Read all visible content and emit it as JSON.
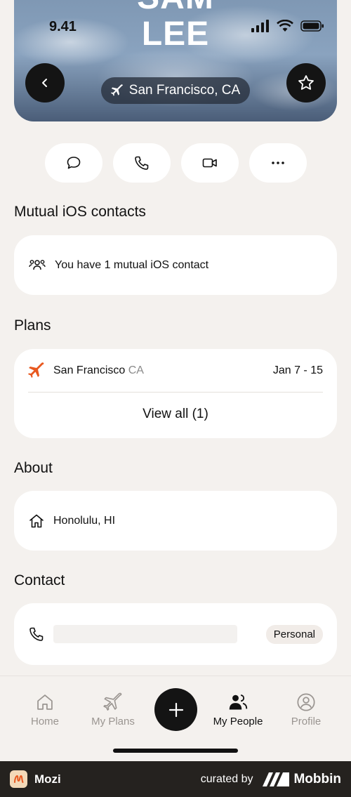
{
  "hero": {
    "name_line1": "SAM",
    "name_line2": "LEE",
    "location": "San Francisco, CA"
  },
  "status_bar": {
    "time": "9.41"
  },
  "sections": {
    "mutual_title": "Mutual iOS contacts",
    "plans_title": "Plans",
    "about_title": "About",
    "contact_title": "Contact"
  },
  "mutual": {
    "text": "You have 1 mutual iOS contact"
  },
  "plans": {
    "city": "San Francisco",
    "state": "CA",
    "dates": "Jan 7 - 15",
    "view_all": "View all (1)"
  },
  "about": {
    "hometown": "Honolulu, HI"
  },
  "contact": {
    "badge": "Personal"
  },
  "tabs": {
    "home": "Home",
    "my_plans": "My Plans",
    "my_people": "My People",
    "profile": "Profile"
  },
  "footer": {
    "app_name": "Mozi",
    "curated_by": "curated by",
    "brand": "Mobbin"
  },
  "colors": {
    "accent": "#e8581f",
    "dark": "#141414",
    "background": "#f4f1ee"
  }
}
